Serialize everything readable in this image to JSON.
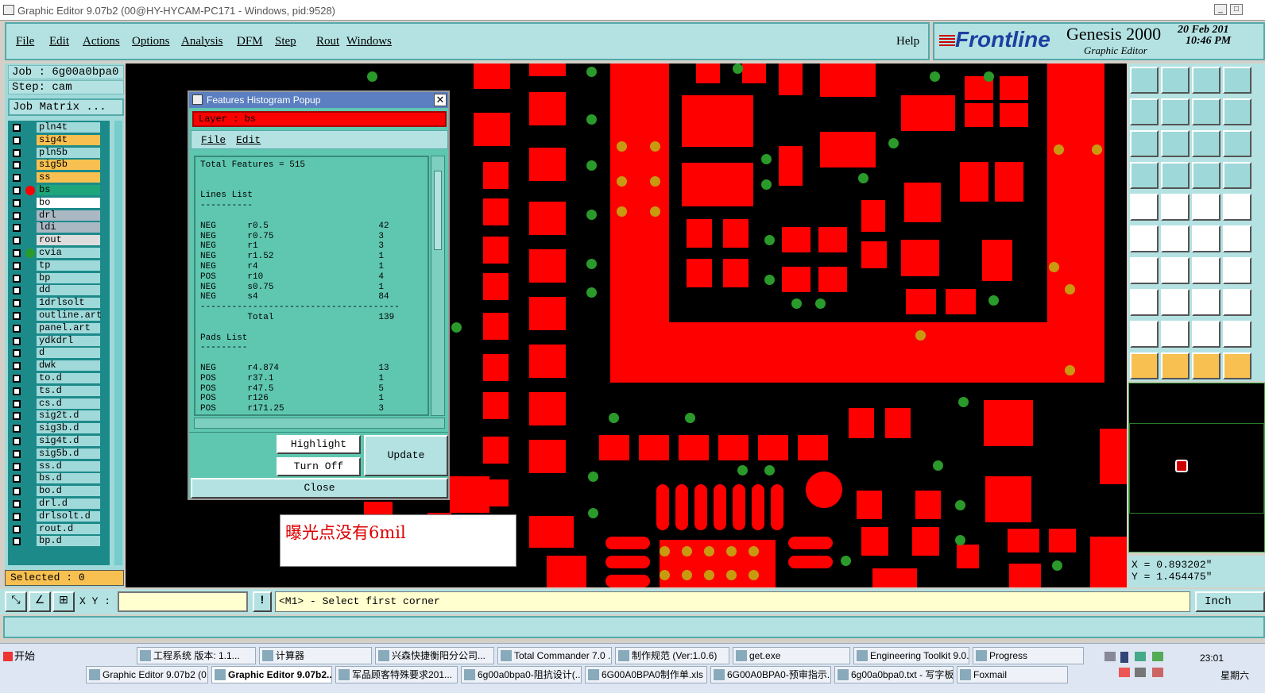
{
  "window": {
    "title": "Graphic Editor 9.07b2 (00@HY-HYCAM-PC171 - Windows, pid:9528)"
  },
  "menu": {
    "items": [
      "File",
      "Edit",
      "Actions",
      "Options",
      "Analysis",
      "DFM",
      "Step",
      "Rout",
      "Windows"
    ],
    "help": "Help"
  },
  "brand": {
    "logo": "Frontline",
    "product": "Genesis 2000",
    "subtitle": "Graphic Editor",
    "date": "20 Feb 201",
    "time": "10:46 PM"
  },
  "job": {
    "label": "Job : 6g00a0bpa0",
    "step": "Step: cam",
    "matrix_button": "Job Matrix ..."
  },
  "layers": [
    {
      "name": "pln4t",
      "color": "#9fd9d9"
    },
    {
      "name": "sig4t",
      "color": "#f7c050"
    },
    {
      "name": "pln5b",
      "color": "#9fd9d9"
    },
    {
      "name": "sig5b",
      "color": "#f7c050"
    },
    {
      "name": "ss",
      "color": "#f7c050"
    },
    {
      "name": "bs",
      "color": "#1fa57a",
      "dot": "#f00"
    },
    {
      "name": "bo",
      "color": "#ffffff"
    },
    {
      "name": "drl",
      "color": "#aab8c4"
    },
    {
      "name": "ldi",
      "color": "#aab8c4"
    },
    {
      "name": "rout",
      "color": "#dddddd"
    },
    {
      "name": "cvia",
      "color": "#9fd9d9",
      "dot": "#2a9a2a"
    },
    {
      "name": "tp",
      "color": "#9fd9d9"
    },
    {
      "name": "bp",
      "color": "#9fd9d9"
    },
    {
      "name": "dd",
      "color": "#9fd9d9"
    },
    {
      "name": "1drlsolt",
      "color": "#9fd9d9"
    },
    {
      "name": "outline.art",
      "color": "#9fd9d9"
    },
    {
      "name": "panel.art",
      "color": "#9fd9d9"
    },
    {
      "name": "ydkdrl",
      "color": "#9fd9d9"
    },
    {
      "name": "d",
      "color": "#9fd9d9"
    },
    {
      "name": "dwk",
      "color": "#9fd9d9"
    },
    {
      "name": "to.d",
      "color": "#9fd9d9"
    },
    {
      "name": "ts.d",
      "color": "#9fd9d9"
    },
    {
      "name": "cs.d",
      "color": "#9fd9d9"
    },
    {
      "name": "sig2t.d",
      "color": "#9fd9d9"
    },
    {
      "name": "sig3b.d",
      "color": "#9fd9d9"
    },
    {
      "name": "sig4t.d",
      "color": "#9fd9d9"
    },
    {
      "name": "sig5b.d",
      "color": "#9fd9d9"
    },
    {
      "name": "ss.d",
      "color": "#9fd9d9"
    },
    {
      "name": "bs.d",
      "color": "#9fd9d9"
    },
    {
      "name": "bo.d",
      "color": "#9fd9d9"
    },
    {
      "name": "drl.d",
      "color": "#9fd9d9"
    },
    {
      "name": "drlsolt.d",
      "color": "#9fd9d9"
    },
    {
      "name": "rout.d",
      "color": "#9fd9d9"
    },
    {
      "name": "bp.d",
      "color": "#9fd9d9"
    }
  ],
  "status": {
    "selected": "Selected : 0"
  },
  "popup": {
    "title": "Features Histogram Popup",
    "layer": "Layer :  bs",
    "menu_file": "File",
    "menu_edit": "Edit",
    "histogram": "Total Features = 515\n\n\nLines List\n----------\n\nNEG      r0.5                     42\nNEG      r0.75                    3\nNEG      r1                       3\nNEG      r1.52                    1\nNEG      r4                       1\nPOS      r10                      4\nNEG      s0.75                    1\nNEG      s4                       84\n--------------------------------------\n         Total                    139\n\nPads List\n---------\n\nNEG      r4.874                   13\nPOS      r37.1                    1\nPOS      r47.5                    5\nPOS      r126                     1\nPOS      r171.25                  3",
    "highlight": "Highlight",
    "turn_off": "Turn Off",
    "update": "Update",
    "close": "Close"
  },
  "annotation": "曝光点没有6mil",
  "coords": {
    "x": "X = 0.893202\"",
    "y": "Y = 1.454475\""
  },
  "cmd": {
    "xy_label": "X Y :",
    "prompt": "<M1> - Select first corner",
    "units": "Inch"
  },
  "taskbar": {
    "start": "开始",
    "row1": [
      "工程系统  版本: 1.1...",
      "计算器",
      "兴森快捷衡阳分公司...",
      "Total Commander 7.0 ...",
      "制作规范 (Ver:1.0.6)",
      "get.exe",
      "Engineering Toolkit 9.0...",
      "Progress"
    ],
    "row2": [
      "Graphic Editor 9.07b2 (0...",
      "Graphic Editor 9.07b2...",
      "军品顾客特殊要求201...",
      "6g00a0bpa0-阻抗设计(...",
      "6G00A0BPA0制作单.xls ...",
      "6G00A0BPA0-预审指示...",
      "6g00a0bpa0.txt - 写字板",
      "Foxmail"
    ],
    "clock": "23:01",
    "day": "星期六"
  }
}
